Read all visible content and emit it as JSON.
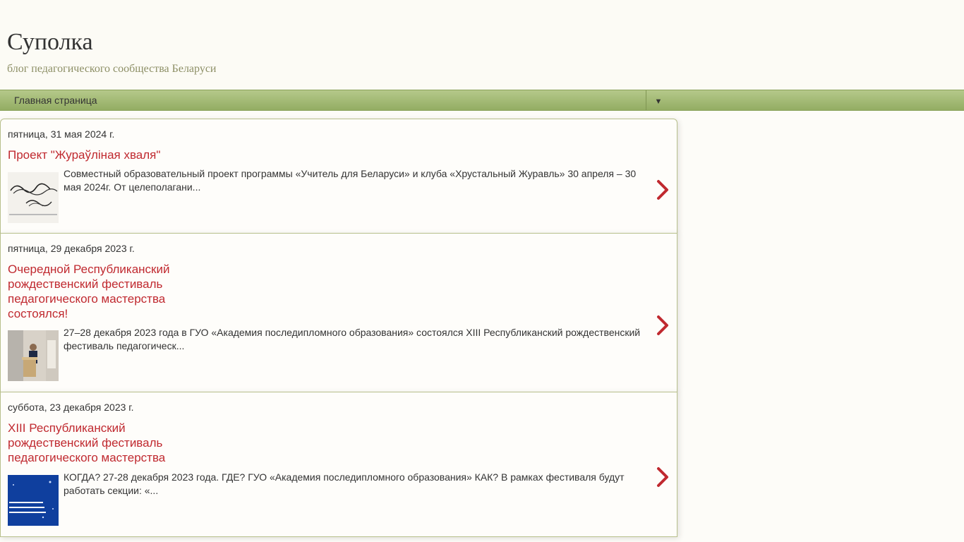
{
  "header": {
    "title": "Суполка",
    "description": "блог педагогического сообщества Беларуси"
  },
  "nav": {
    "home_label": "Главная страница",
    "dropdown_glyph": "▼"
  },
  "posts": [
    {
      "date": "пятница, 31 мая 2024 г.",
      "title": "Проект \"Жураўліная хваля\"",
      "snippet": "Совместный образовательный проект программы «Учитель для Беларуси» и клуба «Хрустальный Журавль» 30 апреля – 30 мая 2024г. От целеполагани..."
    },
    {
      "date": "пятница, 29 декабря 2023 г.",
      "title": "Очередной Республиканский рождественский фестиваль педагогического мастерства состоялся!",
      "snippet": " 27–28 декабря 2023 года в ГУО «Академия последипломного образования» состоялся XIII Республиканский рождественский фестиваль педагогическ..."
    },
    {
      "date": "суббота, 23 декабря 2023 г.",
      "title": "XIII Республиканский рождественский фестиваль педагогического мастерства",
      "snippet": " КОГДА? 27-28 декабря 2023 года. ГДЕ? ГУО «Академия последипломного образования» КАК? В рамках фестиваля будут работать секции: «..."
    }
  ],
  "colors": {
    "accent": "#c0292f",
    "nav_bar": "#a3b975",
    "border": "#b8c08c"
  }
}
